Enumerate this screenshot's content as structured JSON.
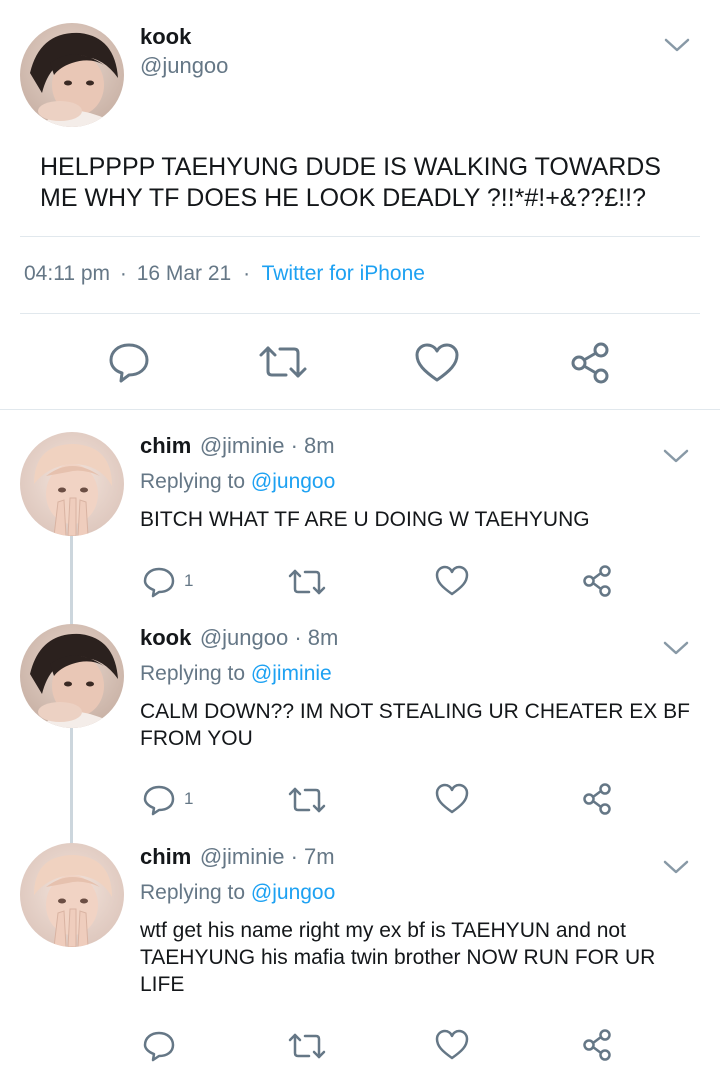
{
  "main_tweet": {
    "name": "kook",
    "handle": "@jungoo",
    "text_line1": "HELPPPP TAEHYUNG DUDE IS WALKING TOWARDS",
    "text_line2": "ME WHY TF DOES HE LOOK DEADLY ?!!*#!+&??£!!?",
    "time": "04:11 pm",
    "date": "16 Mar 21",
    "source": "Twitter for iPhone",
    "sep": "·"
  },
  "replies": [
    {
      "name": "chim",
      "handle": "@jiminie · 8m",
      "replying_prefix": "Replying to",
      "replying_to": "@jungoo",
      "text_line1": "BITCH WHAT TF ARE U DOING W TAEHYUNG",
      "text_line2": "",
      "text_line3": "",
      "reply_count": "1"
    },
    {
      "name": "kook",
      "handle": "@jungoo · 8m",
      "replying_prefix": "Replying to",
      "replying_to": "@jiminie",
      "text_line1": "CALM DOWN?? IM NOT STEALING UR CHEATER EX BF",
      "text_line2": "FROM YOU",
      "text_line3": "",
      "reply_count": "1"
    },
    {
      "name": "chim",
      "handle": "@jiminie · 7m",
      "replying_prefix": "Replying to",
      "replying_to": "@jungoo",
      "text_line1": "wtf get his name right my ex bf is TAEHYUN and not",
      "text_line2": "TAEHYUNG his mafia twin brother NOW RUN FOR UR",
      "text_line3": "LIFE",
      "reply_count": ""
    }
  ],
  "icons": {
    "reply": "reply-icon",
    "retweet": "retweet-icon",
    "like": "heart-icon",
    "share": "share-icon",
    "menu": "chevron-down-icon"
  },
  "colors": {
    "accent": "#1da1f2",
    "muted": "#657786",
    "icon": "#657786",
    "divider": "#e1e8ed"
  }
}
